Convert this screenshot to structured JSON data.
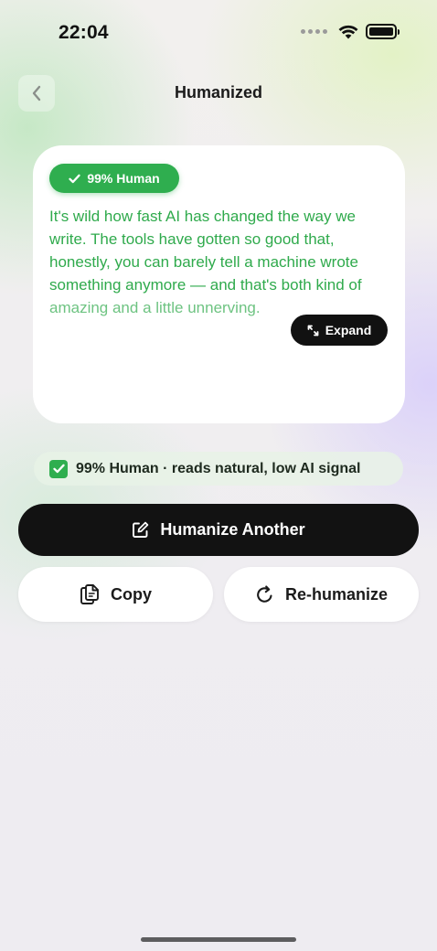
{
  "status_bar": {
    "time": "22:04"
  },
  "nav": {
    "title": "Humanized",
    "back_icon": "chevron-left-icon"
  },
  "card": {
    "badge": "99% Human",
    "text_main": "It's wild how fast AI has changed the way we write. The tools have gotten so good that, honestly, you can barely tell a machine wrote something anymore — and that's both kind of ",
    "text_faded": "amazing and a little unnerving.",
    "expand_label": "Expand"
  },
  "score": {
    "label": "99% Human · reads natural, low AI signal",
    "checked": true
  },
  "actions": {
    "primary_label": "Humanize Another",
    "copy_label": "Copy",
    "rehumanize_label": "Re-humanize"
  },
  "colors": {
    "accent_green": "#2fae4f",
    "primary_dark": "#121212"
  }
}
